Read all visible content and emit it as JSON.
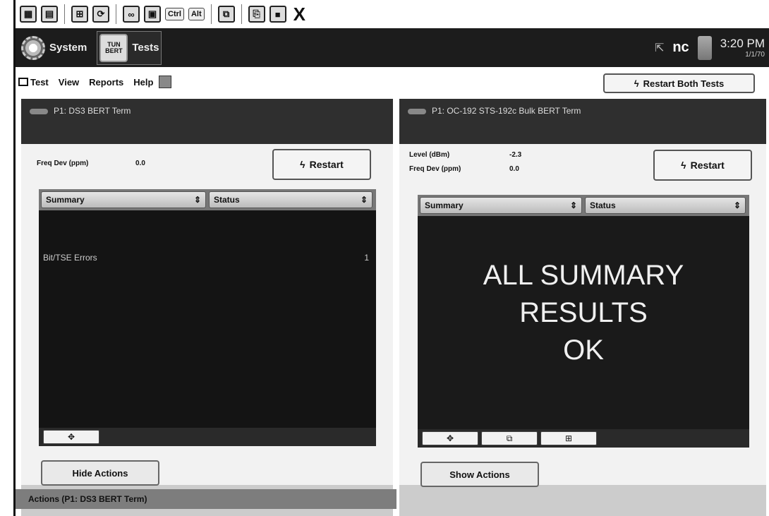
{
  "toolbar": {
    "icons": [
      "chart-icon",
      "document-icon",
      "network-icon",
      "refresh-icon",
      "link-icon",
      "folder-icon"
    ],
    "ctrl_label": "Ctrl",
    "alt_label": "Alt",
    "close_glyph": "X"
  },
  "status_bar": {
    "system_label": "System",
    "tests_label": "Tests",
    "tests_icon_top": "TUN",
    "tests_icon_bottom": "BERT",
    "indicator": "nc",
    "time": "3:20 PM",
    "date": "1/1/70"
  },
  "menu": {
    "items": [
      "Test",
      "View",
      "Reports",
      "Help"
    ],
    "restart_both": "Restart Both Tests"
  },
  "panel_left": {
    "title": "P1: DS3 BERT Term",
    "freq_dev_label": "Freq Dev (ppm)",
    "freq_dev_value": "0.0",
    "restart_label": "Restart",
    "col1": "Summary",
    "col2": "Status",
    "rows": [
      {
        "label": "Bit/TSE Errors",
        "value": "1"
      }
    ],
    "actions_button": "Hide Actions"
  },
  "panel_right": {
    "title": "P1: OC-192 STS-192c Bulk BERT Term",
    "level_label": "Level (dBm)",
    "level_value": "-2.3",
    "freq_dev_label": "Freq Dev (ppm)",
    "freq_dev_value": "0.0",
    "restart_label": "Restart",
    "col1": "Summary",
    "col2": "Status",
    "message_lines": [
      "ALL SUMMARY",
      "RESULTS",
      "OK"
    ],
    "actions_button": "Show Actions"
  },
  "actions_bar": {
    "label": "Actions (P1: DS3 BERT Term)"
  },
  "colors": {
    "status_bar_bg": "#1c1c1c",
    "result_bg": "#141414"
  }
}
